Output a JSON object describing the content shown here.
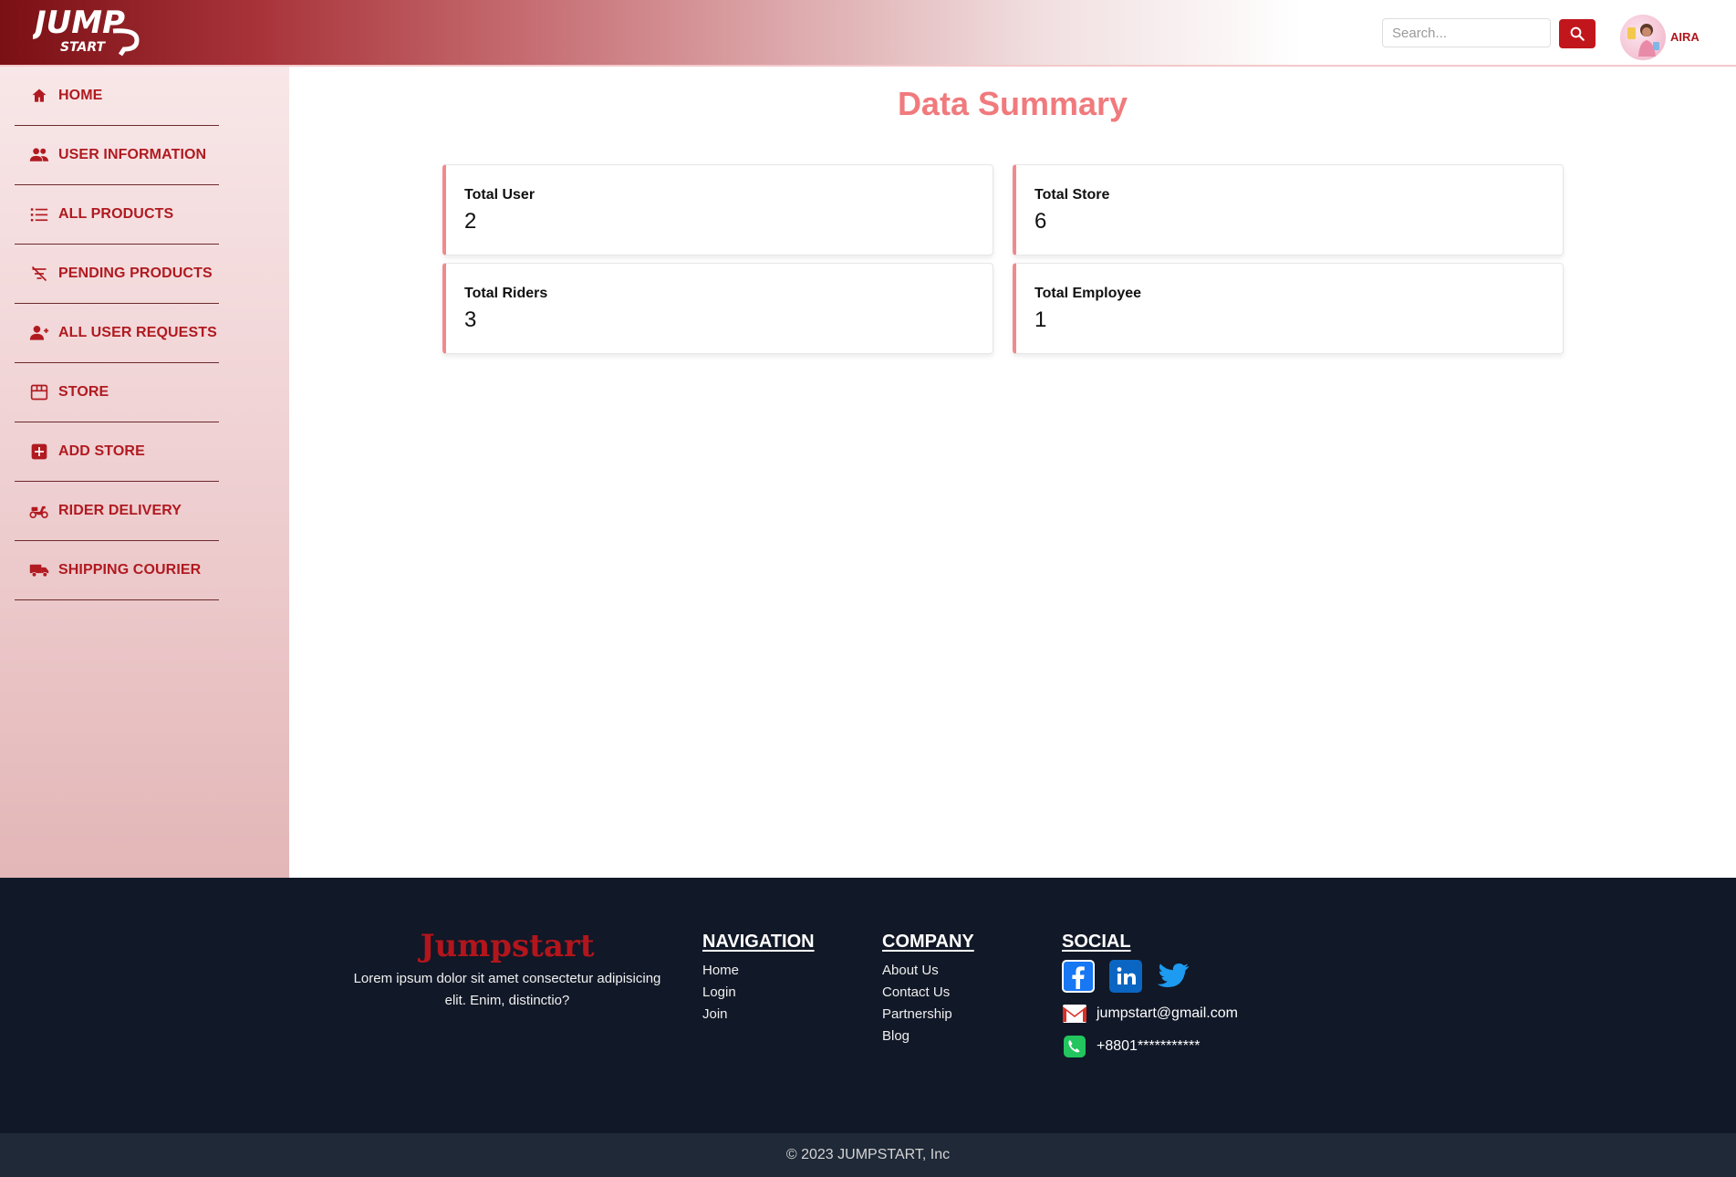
{
  "header": {
    "logo_text_top": "JUMP",
    "logo_text_bottom": "START",
    "search_placeholder": "Search...",
    "user_name": "AIRA"
  },
  "sidebar": {
    "items": [
      {
        "label": "HOME",
        "icon": "home-icon"
      },
      {
        "label": "USER INFORMATION",
        "icon": "users-icon"
      },
      {
        "label": "ALL PRODUCTS",
        "icon": "list-icon"
      },
      {
        "label": "PENDING PRODUCTS",
        "icon": "filter-off-icon"
      },
      {
        "label": "ALL USER REQUESTS",
        "icon": "user-add-icon"
      },
      {
        "label": "STORE",
        "icon": "storefront-icon"
      },
      {
        "label": "ADD STORE",
        "icon": "plus-box-icon"
      },
      {
        "label": "RIDER DELIVERY",
        "icon": "scooter-icon"
      },
      {
        "label": "SHIPPING COURIER",
        "icon": "truck-icon"
      }
    ]
  },
  "main": {
    "title": "Data Summary",
    "cards": [
      {
        "label": "Total User",
        "value": "2"
      },
      {
        "label": "Total Store",
        "value": "6"
      },
      {
        "label": "Total Riders",
        "value": "3"
      },
      {
        "label": "Total Employee",
        "value": "1"
      }
    ]
  },
  "footer": {
    "brand_name": "Jumpstart",
    "brand_desc": "Lorem ipsum dolor sit amet consectetur adipisicing elit. Enim, distinctio?",
    "navigation": {
      "title": "NAVIGATION",
      "links": [
        "Home",
        "Login",
        "Join"
      ]
    },
    "company": {
      "title": "COMPANY",
      "links": [
        "About Us",
        "Contact Us",
        "Partnership",
        "Blog"
      ]
    },
    "social": {
      "title": "SOCIAL",
      "icons": [
        "facebook-icon",
        "linkedin-icon",
        "twitter-icon"
      ],
      "email": "jumpstart@gmail.com",
      "phone": "+8801***********"
    },
    "copyright": "© 2023 JUMPSTART, Inc"
  },
  "colors": {
    "brand_red": "#b01a20",
    "accent_pink": "#f07a7d",
    "footer_bg": "#111827",
    "copyright_bg": "#1f2937"
  }
}
